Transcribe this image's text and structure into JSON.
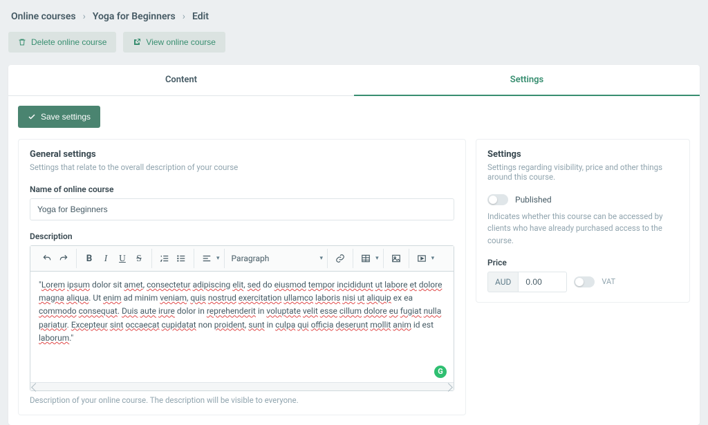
{
  "breadcrumb": {
    "root": "Online courses",
    "course": "Yoga for Beginners",
    "page": "Edit"
  },
  "actions": {
    "delete": "Delete online course",
    "view": "View online course"
  },
  "tabs": {
    "content": "Content",
    "settings": "Settings"
  },
  "save_button": "Save settings",
  "general": {
    "title": "General settings",
    "subtitle": "Settings that relate to the overall description of your course",
    "name_label": "Name of online course",
    "name_value": "Yoga for Beginners",
    "desc_label": "Description",
    "desc_help": "Description of your online course. The description will be visible to everyone.",
    "paragraph_label": "Paragraph",
    "body_plain": "\"Lorem ipsum dolor sit amet, consectetur adipiscing elit, sed do eiusmod tempor incididunt ut labore et dolore magna aliqua. Ut enim ad minim veniam, quis nostrud exercitation ullamco laboris nisi ut aliquip ex ea commodo consequat. Duis aute irure dolor in reprehenderit in voluptate velit esse cillum dolore eu fugiat nulla pariatur. Excepteur sint occaecat cupidatat non proident, sunt in culpa qui officia deserunt mollit anim id est laborum.\""
  },
  "settings_panel": {
    "title": "Settings",
    "subtitle": "Settings regarding visibility, price and other things around this course.",
    "published_label": "Published",
    "published_desc": "Indicates whether this course can be accessed by clients who have already purchased access to the course.",
    "price_label": "Price",
    "currency": "AUD",
    "price_value": "0.00",
    "vat_label": "VAT"
  }
}
